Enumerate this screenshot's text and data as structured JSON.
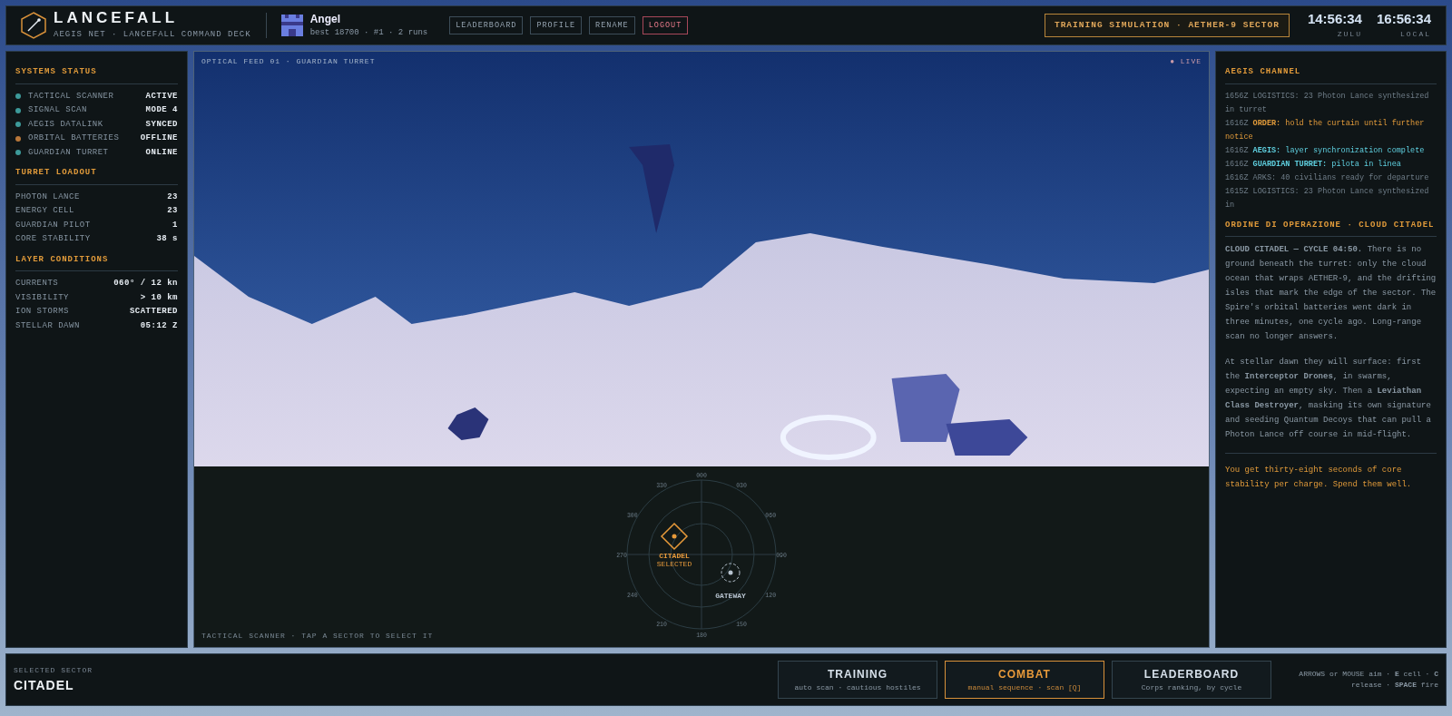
{
  "header": {
    "logo_title": "LANCEFALL",
    "logo_subtitle": "AEGIS NET · LANCEFALL COMMAND DECK",
    "user": {
      "name": "Angel",
      "stats": "best 18700 · #1 · 2 runs"
    },
    "buttons": [
      {
        "label": "LEADERBOARD",
        "kind": "normal"
      },
      {
        "label": "PROFILE",
        "kind": "normal"
      },
      {
        "label": "RENAME",
        "kind": "normal"
      },
      {
        "label": "LOGOUT",
        "kind": "danger"
      }
    ],
    "mode_badge": "TRAINING SIMULATION · AETHER-9 SECTOR",
    "clocks": [
      {
        "time": "14:56:34",
        "label": "ZULU"
      },
      {
        "time": "16:56:34",
        "label": "LOCAL"
      }
    ]
  },
  "left_panel": {
    "sections": [
      {
        "title": "SYSTEMS STATUS",
        "rows": [
          {
            "label": "TACTICAL SCANNER",
            "value": "ACTIVE",
            "color": "#3d9a9a"
          },
          {
            "label": "SIGNAL SCAN",
            "value": "MODE 4",
            "color": "#3d9a9a"
          },
          {
            "label": "AEGIS DATALINK",
            "value": "SYNCED",
            "color": "#3d9a9a"
          },
          {
            "label": "ORBITAL BATTERIES",
            "value": "OFFLINE",
            "color": "#b8773a"
          },
          {
            "label": "GUARDIAN TURRET",
            "value": "ONLINE",
            "color": "#3d9a9a"
          }
        ]
      },
      {
        "title": "TURRET LOADOUT",
        "rows": [
          {
            "label": "PHOTON LANCE",
            "value": "23"
          },
          {
            "label": "ENERGY CELL",
            "value": "23"
          },
          {
            "label": "GUARDIAN PILOT",
            "value": "1"
          },
          {
            "label": "CORE STABILITY",
            "value": "38 s"
          }
        ]
      },
      {
        "title": "LAYER CONDITIONS",
        "rows": [
          {
            "label": "CURRENTS",
            "value": "060° / 12 kn"
          },
          {
            "label": "VISIBILITY",
            "value": "> 10 km"
          },
          {
            "label": "ION STORMS",
            "value": "SCATTERED"
          },
          {
            "label": "STELLAR DAWN",
            "value": "05:12 Z"
          }
        ]
      }
    ]
  },
  "feed": {
    "title": "OPTICAL FEED 01 · GUARDIAN TURRET",
    "live": "● LIVE"
  },
  "scanner": {
    "caption": "TACTICAL SCANNER · TAP A SECTOR TO SELECT IT",
    "bearings": [
      "000",
      "030",
      "060",
      "090",
      "120",
      "150",
      "180",
      "210",
      "240",
      "270",
      "300",
      "330"
    ],
    "sectors": [
      {
        "name": "CITADEL",
        "state_label": "SELECTED",
        "kind": "citadel",
        "selected": true
      },
      {
        "name": "GATEWAY",
        "kind": "gateway",
        "selected": false
      }
    ]
  },
  "right_panel": {
    "channel_title": "AEGIS CHANNEL",
    "log": [
      {
        "time": "1656Z",
        "source": "LOGISTICS:",
        "text": "23 Photon Lance synthesized in turret",
        "kind": "plain"
      },
      {
        "time": "1616Z",
        "source": "ORDER:",
        "text": "hold the curtain until further notice",
        "kind": "order"
      },
      {
        "time": "1616Z",
        "source": "AEGIS:",
        "text": "layer synchronization complete",
        "kind": "aegis"
      },
      {
        "time": "1616Z",
        "source": "GUARDIAN TURRET:",
        "text": "pilota in linea",
        "kind": "aegis"
      },
      {
        "time": "1616Z",
        "source": "ARKS:",
        "text": "40 civilians ready for departure",
        "kind": "plain"
      },
      {
        "time": "1615Z",
        "source": "LOGISTICS:",
        "text": "23 Photon Lance synthesized in",
        "kind": "plain"
      }
    ],
    "briefing_title": "ORDINE DI OPERAZIONE · CLOUD CITADEL",
    "briefing": [
      {
        "kind": "body",
        "text": "**CLOUD CITADEL — CYCLE 04:50.** There is no ground beneath the turret: only the cloud ocean that wraps AETHER-9, and the drifting isles that mark the edge of the sector. The Spire's orbital batteries went dark in three minutes, one cycle ago. Long-range scan no longer answers."
      },
      {
        "kind": "body",
        "text": "At stellar dawn they will surface: first the **Interceptor Drones**, in swarms, expecting an empty sky. Then a **Leviathan Class Destroyer**, masking its own signature and seeding Quantum Decoys that can pull a Photon Lance off course in mid-flight."
      },
      {
        "kind": "note",
        "text": "You get thirty-eight seconds of core stability per charge. Spend them well."
      }
    ]
  },
  "footer": {
    "sector_caption": "SELECTED SECTOR",
    "sector_name": "CITADEL",
    "modes": [
      {
        "title": "TRAINING",
        "subtitle": "auto scan · cautious hostiles",
        "selected": false
      },
      {
        "title": "COMBAT",
        "subtitle": "manual sequence · scan [Q]",
        "selected": true
      },
      {
        "title": "LEADERBOARD",
        "subtitle": "Corps ranking, by cycle",
        "selected": false
      }
    ],
    "keys_hint": "ARROWS or MOUSE aim · **E** cell · **C** release · **SPACE** fire"
  }
}
